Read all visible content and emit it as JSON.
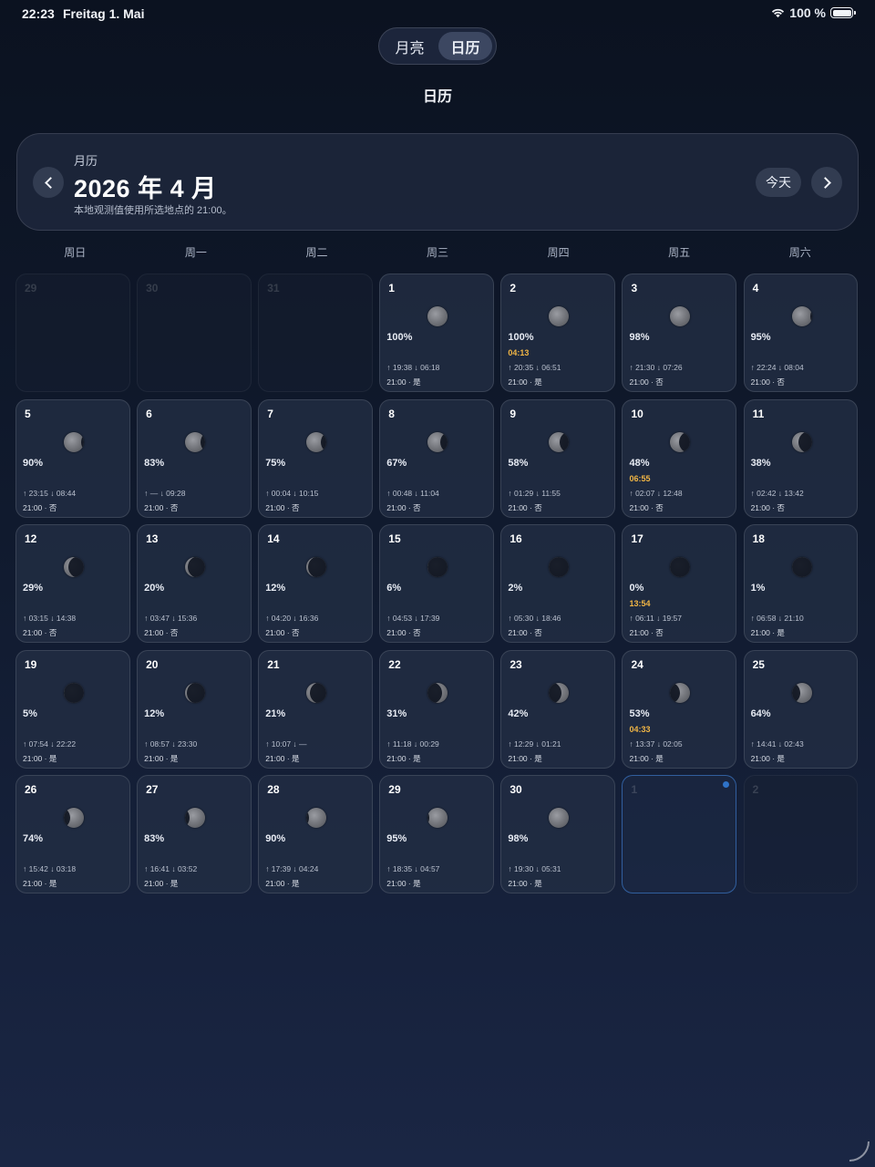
{
  "status": {
    "time": "22:23",
    "date": "Freitag 1. Mai",
    "battery": "100 %"
  },
  "segment": {
    "moon_label": "月亮",
    "calendar_label": "日历"
  },
  "page_title": "日历",
  "header": {
    "subtitle": "月历",
    "title": "2026 年 4 月",
    "note": "本地观测值使用所选地点的 21:00。",
    "today_label": "今天"
  },
  "weekdays": [
    "周日",
    "周一",
    "周二",
    "周三",
    "周四",
    "周五",
    "周六"
  ],
  "colors": {
    "event": "#f0b545",
    "today_dot": "#2f73c8"
  },
  "days": [
    {
      "n": "29",
      "dim": true
    },
    {
      "n": "30",
      "dim": true
    },
    {
      "n": "31",
      "dim": true
    },
    {
      "n": "1",
      "pct": "100%",
      "phase": 1.0,
      "rs": "↑ 19:38  ↓ 06:18",
      "obs": "21:00 · 是"
    },
    {
      "n": "2",
      "pct": "100%",
      "phase": 1.0,
      "event": "04:13",
      "rs": "↑ 20:35  ↓ 06:51",
      "obs": "21:00 · 是"
    },
    {
      "n": "3",
      "pct": "98%",
      "phase": 0.98,
      "rs": "↑ 21:30  ↓ 07:26",
      "obs": "21:00 · 否"
    },
    {
      "n": "4",
      "pct": "95%",
      "phase": 0.95,
      "rs": "↑ 22:24  ↓ 08:04",
      "obs": "21:00 · 否"
    },
    {
      "n": "5",
      "pct": "90%",
      "phase": 0.9,
      "rs": "↑ 23:15  ↓ 08:44",
      "obs": "21:00 · 否"
    },
    {
      "n": "6",
      "pct": "83%",
      "phase": 0.83,
      "rs": "↑ —  ↓ 09:28",
      "obs": "21:00 · 否"
    },
    {
      "n": "7",
      "pct": "75%",
      "phase": 0.75,
      "rs": "↑ 00:04  ↓ 10:15",
      "obs": "21:00 · 否"
    },
    {
      "n": "8",
      "pct": "67%",
      "phase": 0.67,
      "rs": "↑ 00:48  ↓ 11:04",
      "obs": "21:00 · 否"
    },
    {
      "n": "9",
      "pct": "58%",
      "phase": 0.58,
      "rs": "↑ 01:29  ↓ 11:55",
      "obs": "21:00 · 否"
    },
    {
      "n": "10",
      "pct": "48%",
      "phase": 0.48,
      "event": "06:55",
      "rs": "↑ 02:07  ↓ 12:48",
      "obs": "21:00 · 否"
    },
    {
      "n": "11",
      "pct": "38%",
      "phase": 0.38,
      "rs": "↑ 02:42  ↓ 13:42",
      "obs": "21:00 · 否"
    },
    {
      "n": "12",
      "pct": "29%",
      "phase": 0.29,
      "rs": "↑ 03:15  ↓ 14:38",
      "obs": "21:00 · 否"
    },
    {
      "n": "13",
      "pct": "20%",
      "phase": 0.2,
      "rs": "↑ 03:47  ↓ 15:36",
      "obs": "21:00 · 否"
    },
    {
      "n": "14",
      "pct": "12%",
      "phase": 0.12,
      "rs": "↑ 04:20  ↓ 16:36",
      "obs": "21:00 · 否"
    },
    {
      "n": "15",
      "pct": "6%",
      "phase": 0.06,
      "rs": "↑ 04:53  ↓ 17:39",
      "obs": "21:00 · 否"
    },
    {
      "n": "16",
      "pct": "2%",
      "phase": 0.02,
      "rs": "↑ 05:30  ↓ 18:46",
      "obs": "21:00 · 否"
    },
    {
      "n": "17",
      "pct": "0%",
      "phase": 0.0,
      "event": "13:54",
      "rs": "↑ 06:11  ↓ 19:57",
      "obs": "21:00 · 否"
    },
    {
      "n": "18",
      "pct": "1%",
      "phase": 0.01,
      "rs": "↑ 06:58  ↓ 21:10",
      "obs": "21:00 · 是"
    },
    {
      "n": "19",
      "pct": "5%",
      "phase": 0.05,
      "rs": "↑ 07:54  ↓ 22:22",
      "obs": "21:00 · 是"
    },
    {
      "n": "20",
      "pct": "12%",
      "phase": 0.12,
      "rs": "↑ 08:57  ↓ 23:30",
      "obs": "21:00 · 是"
    },
    {
      "n": "21",
      "pct": "21%",
      "phase": 0.21,
      "rs": "↑ 10:07  ↓ —",
      "obs": "21:00 · 是"
    },
    {
      "n": "22",
      "pct": "31%",
      "phase": 0.31,
      "rs": "↑ 11:18  ↓ 00:29",
      "obs": "21:00 · 是"
    },
    {
      "n": "23",
      "pct": "42%",
      "phase": 0.42,
      "rs": "↑ 12:29  ↓ 01:21",
      "obs": "21:00 · 是"
    },
    {
      "n": "24",
      "pct": "53%",
      "phase": 0.53,
      "event": "04:33",
      "rs": "↑ 13:37  ↓ 02:05",
      "obs": "21:00 · 是"
    },
    {
      "n": "25",
      "pct": "64%",
      "phase": 0.64,
      "rs": "↑ 14:41  ↓ 02:43",
      "obs": "21:00 · 是"
    },
    {
      "n": "26",
      "pct": "74%",
      "phase": 0.74,
      "rs": "↑ 15:42  ↓ 03:18",
      "obs": "21:00 · 是"
    },
    {
      "n": "27",
      "pct": "83%",
      "phase": 0.83,
      "rs": "↑ 16:41  ↓ 03:52",
      "obs": "21:00 · 是"
    },
    {
      "n": "28",
      "pct": "90%",
      "phase": 0.9,
      "rs": "↑ 17:39  ↓ 04:24",
      "obs": "21:00 · 是"
    },
    {
      "n": "29",
      "pct": "95%",
      "phase": 0.95,
      "rs": "↑ 18:35  ↓ 04:57",
      "obs": "21:00 · 是"
    },
    {
      "n": "30",
      "pct": "98%",
      "phase": 0.98,
      "rs": "↑ 19:30  ↓ 05:31",
      "obs": "21:00 · 是"
    },
    {
      "n": "1",
      "dim": true,
      "selected": true,
      "today": true
    },
    {
      "n": "2",
      "dim": true
    }
  ]
}
